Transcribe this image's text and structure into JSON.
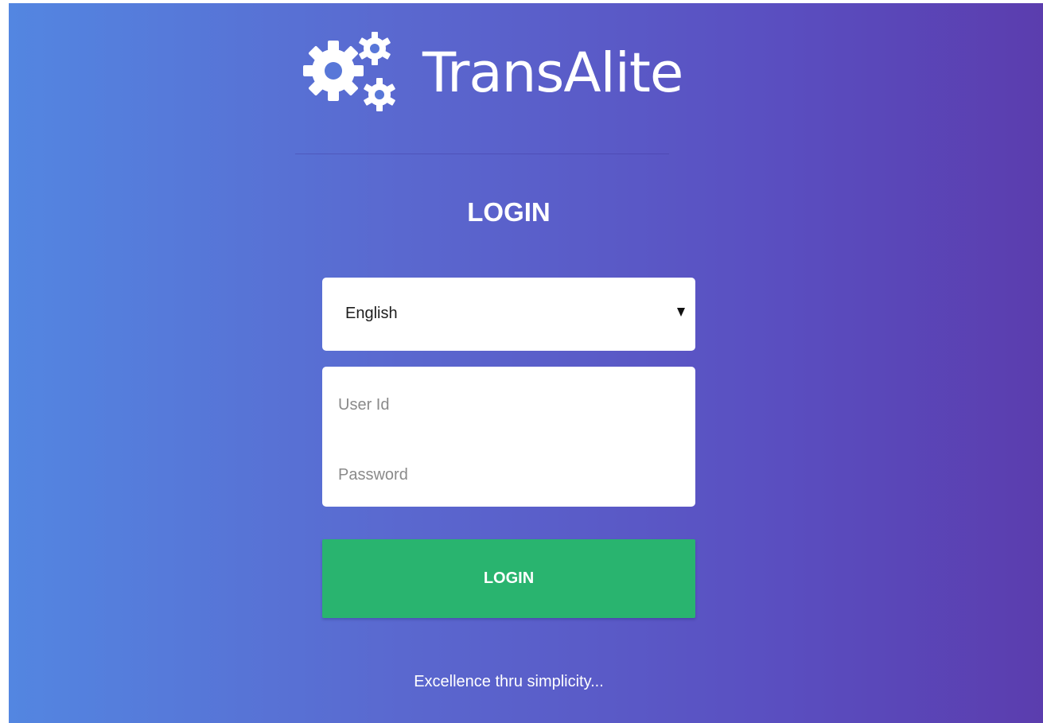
{
  "brand": {
    "name": "TransAlite",
    "logo_icon": "gears-icon"
  },
  "login": {
    "heading": "LOGIN",
    "language": {
      "selected": "English",
      "icon": "caret-down-icon"
    },
    "user_id": {
      "value": "",
      "placeholder": "User Id"
    },
    "password": {
      "value": "",
      "placeholder": "Password"
    },
    "submit_label": "LOGIN"
  },
  "tagline": "Excellence thru simplicity...",
  "colors": {
    "gradient_start": "#5386e1",
    "gradient_end": "#5b3dae",
    "button": "#29b46f",
    "text_light": "#ffffff"
  }
}
